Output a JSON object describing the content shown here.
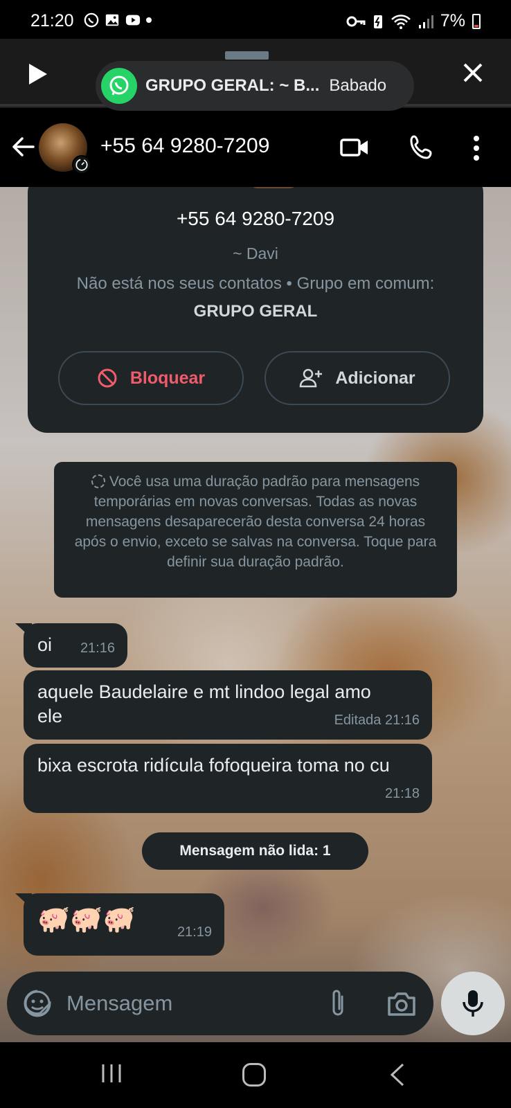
{
  "status_bar": {
    "time": "21:20",
    "battery": "7%",
    "icons": [
      "whatsapp-icon",
      "gallery-icon",
      "youtube-icon",
      "dot-icon",
      "key-icon",
      "battery-saver-icon",
      "wifi-icon",
      "signal-icon",
      "battery-icon"
    ]
  },
  "media_notification": {
    "title": "GRUPO GERAL: ~ B...",
    "subtitle": "Babado",
    "icons": [
      "play-icon",
      "whatsapp-icon",
      "close-icon"
    ]
  },
  "header": {
    "title": "+55 64 9280-7209",
    "icons": [
      "back-arrow-icon",
      "disappearing-timer-icon",
      "video-call-icon",
      "voice-call-icon",
      "more-vert-icon"
    ]
  },
  "contact_card": {
    "phone": "+55 64 9280-7209",
    "name": "~ Davi",
    "info_text": "Não está nos seus contatos • Grupo em comum: ",
    "group_name": "GRUPO GERAL",
    "block_label": "Bloquear",
    "add_label": "Adicionar"
  },
  "system_note": {
    "text": "Você usa uma duração padrão para mensagens temporárias em novas conversas. Todas as novas mensagens desaparecerão desta conversa 24 horas após o envio, exceto se salvas na conversa. Toque para definir sua duração padrão."
  },
  "messages": [
    {
      "text": "oi",
      "time": "21:16"
    },
    {
      "text": "aquele Baudelaire e mt lindoo legal amo ele",
      "time": "Editada 21:16"
    },
    {
      "text": "bixa escrota ridícula fofoqueira toma no cu",
      "time": "21:18"
    },
    {
      "text": "🐖🐖🐖",
      "time": "21:19"
    }
  ],
  "unread_divider": "Mensagem não lida: 1",
  "composer": {
    "placeholder": "Mensagem",
    "icons": [
      "sticker-icon",
      "attach-icon",
      "camera-icon",
      "mic-icon"
    ]
  },
  "colors": {
    "bubble": "#1f2427",
    "whatsapp_green": "#25d366",
    "block_red": "#f15c6d",
    "muted_text": "#8696a0"
  }
}
